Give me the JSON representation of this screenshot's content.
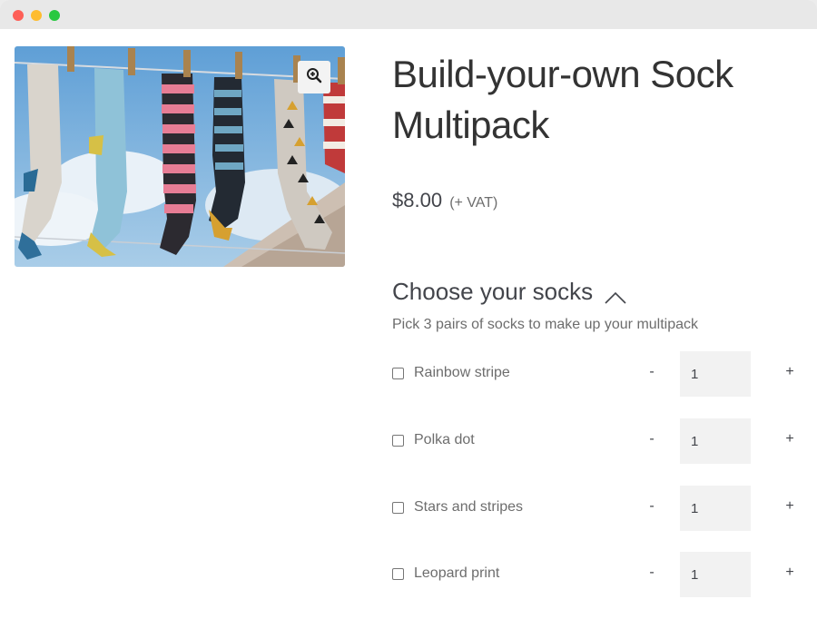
{
  "window": {
    "controls": [
      "close",
      "minimize",
      "maximize"
    ]
  },
  "product": {
    "title": "Build-your-own Sock Multipack",
    "price": "$8.00",
    "tax_note": "(+ VAT)",
    "image_alt": "Colorful socks hanging on a clothesline",
    "zoom_icon": "zoom-in-icon"
  },
  "section": {
    "heading": "Choose your socks",
    "toggle_icon": "chevron-up-icon",
    "description": "Pick 3 pairs of socks to make up your multipack"
  },
  "options": [
    {
      "label": "Rainbow stripe",
      "minus": "-",
      "qty": "1",
      "plus": "+"
    },
    {
      "label": "Polka dot",
      "minus": "-",
      "qty": "1",
      "plus": "+"
    },
    {
      "label": "Stars and stripes",
      "minus": "-",
      "qty": "1",
      "plus": "+"
    },
    {
      "label": "Leopard print",
      "minus": "-",
      "qty": "1",
      "plus": "+"
    }
  ]
}
